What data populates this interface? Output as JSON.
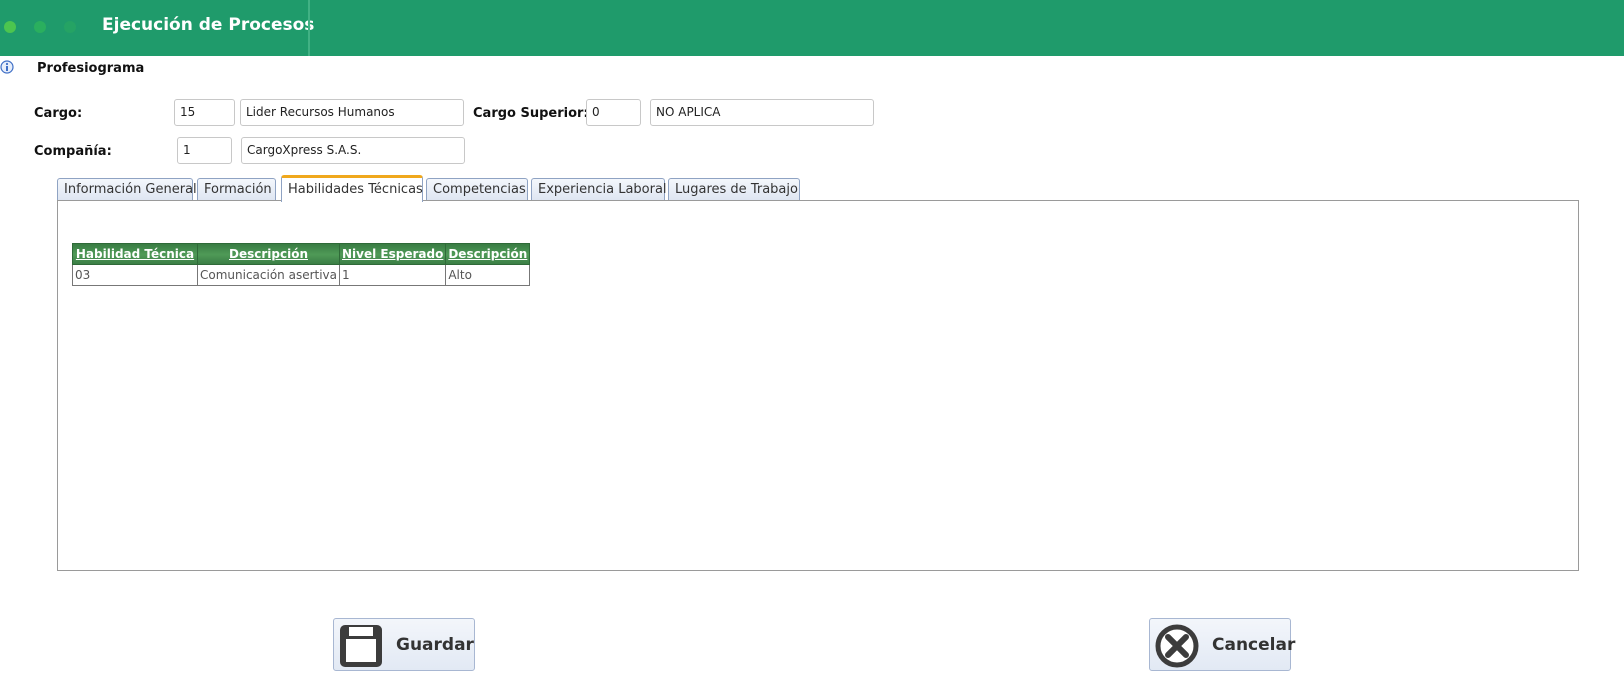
{
  "header": {
    "title": "Ejecución de Procesos"
  },
  "form": {
    "section_title": "Profesiograma",
    "cargo": {
      "label": "Cargo:",
      "code": "15",
      "name": "Lider Recursos Humanos"
    },
    "cargo_superior": {
      "label": "Cargo Superior:",
      "code": "0",
      "name": "NO APLICA"
    },
    "compania": {
      "label": "Compañía:",
      "code": "1",
      "name": "CargoXpress S.A.S."
    }
  },
  "tabs": [
    {
      "label": "Información General"
    },
    {
      "label": "Formación"
    },
    {
      "label": "Habilidades Técnicas",
      "active": true
    },
    {
      "label": "Competencias"
    },
    {
      "label": "Experiencia Laboral"
    },
    {
      "label": "Lugares de Trabajo"
    }
  ],
  "table": {
    "columns": [
      "Habilidad Técnica",
      "Descripción",
      "Nivel Esperado",
      "Descripción"
    ],
    "rows": [
      [
        "03",
        "Comunicación asertiva",
        "1",
        "Alto"
      ]
    ]
  },
  "buttons": {
    "save_label": "Guardar",
    "cancel_label": "Cancelar"
  },
  "icons": {
    "info": "info-icon",
    "save": "floppy-disk-icon",
    "cancel": "cancel-circle-icon"
  },
  "colors": {
    "header_bg": "#1f9b6b",
    "table_header_bg": "#3a7d44",
    "active_tab_accent": "#f0a81c"
  }
}
